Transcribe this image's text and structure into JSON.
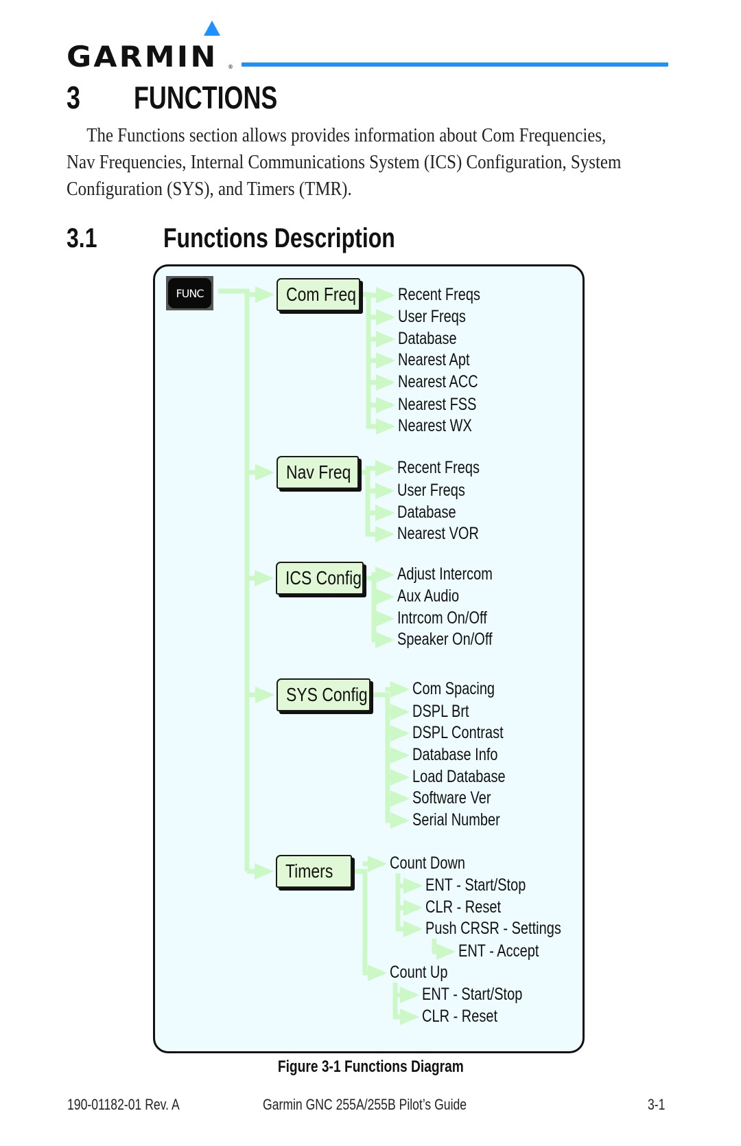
{
  "header": {
    "logo_text": "GARMIN",
    "logo_registered": "®",
    "accent_color": "#1e90ff"
  },
  "chapter": {
    "number": "3",
    "title": "FUNCTIONS"
  },
  "intro_lines": [
    "The Functions section allows provides information about Com Frequencies,",
    "Nav Frequencies, Internal Communications System (ICS) Configuration, System",
    "Configuration (SYS), and Timers (TMR)."
  ],
  "section": {
    "number": "3.1",
    "title": "Functions Description"
  },
  "diagram": {
    "key_label": "FUNC",
    "box_fill": "#e0f8d6",
    "connector_color": "#ccf8c6",
    "background": "#eefcff",
    "menus": [
      {
        "label": "Com Freq",
        "items": [
          {
            "label": "Recent Freqs"
          },
          {
            "label": "User Freqs"
          },
          {
            "label": "Database"
          },
          {
            "label": "Nearest Apt"
          },
          {
            "label": "Nearest ACC"
          },
          {
            "label": "Nearest FSS"
          },
          {
            "label": "Nearest WX"
          }
        ]
      },
      {
        "label": "Nav Freq",
        "items": [
          {
            "label": "Recent Freqs"
          },
          {
            "label": "User Freqs"
          },
          {
            "label": "Database"
          },
          {
            "label": "Nearest VOR"
          }
        ]
      },
      {
        "label": "ICS Config",
        "items": [
          {
            "label": "Adjust Intercom"
          },
          {
            "label": "Aux Audio"
          },
          {
            "label": "Intrcom On/Off"
          },
          {
            "label": "Speaker On/Off"
          }
        ]
      },
      {
        "label": "SYS Config",
        "items": [
          {
            "label": "Com Spacing"
          },
          {
            "label": "DSPL Brt"
          },
          {
            "label": "DSPL Contrast"
          },
          {
            "label": "Database Info"
          },
          {
            "label": "Load Database"
          },
          {
            "label": "Software Ver"
          },
          {
            "label": "Serial Number"
          }
        ]
      },
      {
        "label": "Timers",
        "items": [
          {
            "label": "Count Down",
            "children": [
              {
                "label": "ENT - Start/Stop"
              },
              {
                "label": "CLR - Reset"
              },
              {
                "label": "Push CRSR - Settings",
                "children": [
                  {
                    "label": "ENT - Accept"
                  }
                ]
              }
            ]
          },
          {
            "label": "Count Up",
            "children": [
              {
                "label": "ENT - Start/Stop"
              },
              {
                "label": "CLR - Reset"
              }
            ]
          }
        ]
      }
    ]
  },
  "caption": "Figure 3-1  Functions Diagram",
  "footer": {
    "doc_number": "190-01182-01  Rev. A",
    "guide_title": "Garmin GNC 255A/255B Pilot’s Guide",
    "page_number": "3-1"
  }
}
